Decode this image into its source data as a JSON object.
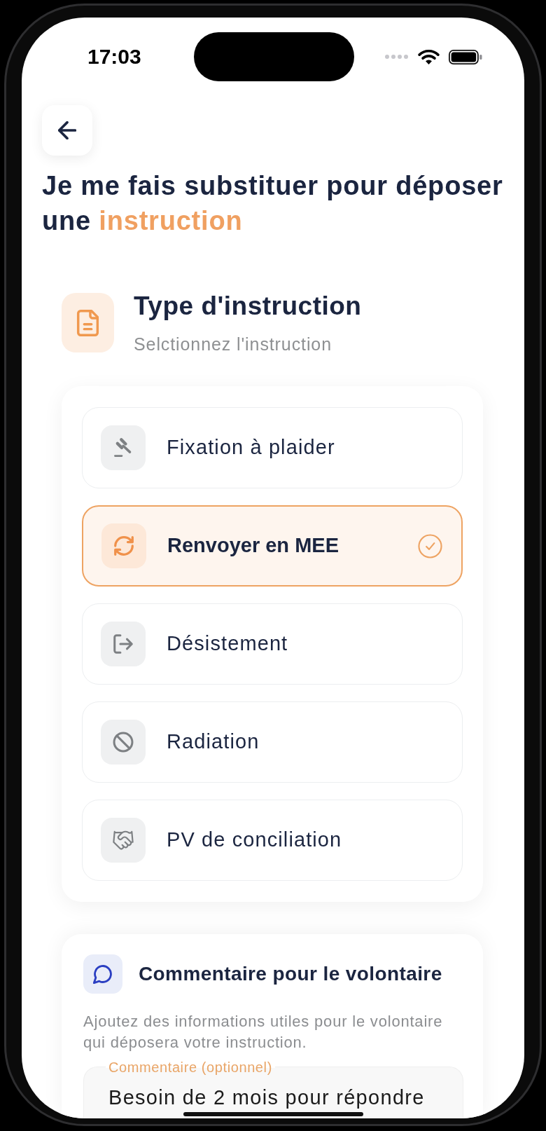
{
  "status_bar": {
    "time": "17:03"
  },
  "title": {
    "text": "Je me fais substituer pour déposer une",
    "highlight": "instruction"
  },
  "instruction_section": {
    "title": "Type d'instruction",
    "subtitle": "Selctionnez l'instruction",
    "options": [
      {
        "label": "Fixation à plaider",
        "selected": false
      },
      {
        "label": "Renvoyer en MEE",
        "selected": true
      },
      {
        "label": "Désistement",
        "selected": false
      },
      {
        "label": "Radiation",
        "selected": false
      },
      {
        "label": "PV de conciliation",
        "selected": false
      }
    ]
  },
  "comment_section": {
    "title": "Commentaire pour le volontaire",
    "description": "Ajoutez des informations utiles pour le volontaire qui déposera votre instruction.",
    "field": {
      "label": "Commentaire (optionnel)",
      "value": "Besoin de 2 mois pour répondre"
    }
  }
}
